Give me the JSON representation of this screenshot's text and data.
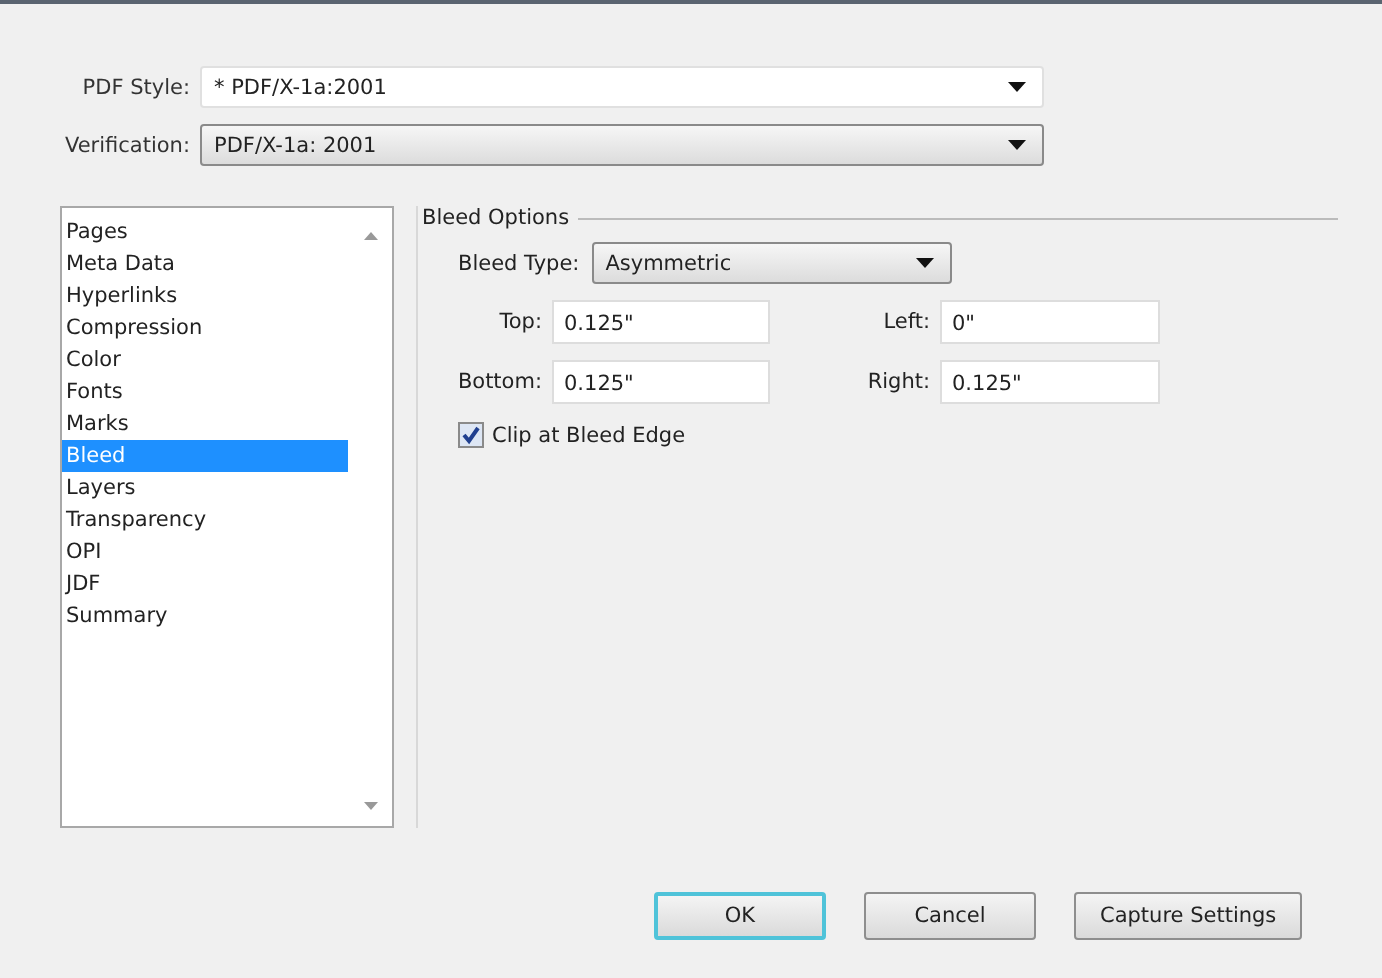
{
  "header_fields": [
    {
      "label": "PDF Style:",
      "value": "* PDF/X-1a:2001",
      "kind": "editable"
    },
    {
      "label": "Verification:",
      "value": "PDF/X-1a: 2001",
      "kind": "dropdown"
    }
  ],
  "sidebar": {
    "items": [
      {
        "label": "Pages",
        "selected": false
      },
      {
        "label": "Meta Data",
        "selected": false
      },
      {
        "label": "Hyperlinks",
        "selected": false
      },
      {
        "label": "Compression",
        "selected": false
      },
      {
        "label": "Color",
        "selected": false
      },
      {
        "label": "Fonts",
        "selected": false
      },
      {
        "label": "Marks",
        "selected": false
      },
      {
        "label": "Bleed",
        "selected": true
      },
      {
        "label": "Layers",
        "selected": false
      },
      {
        "label": "Transparency",
        "selected": false
      },
      {
        "label": "OPI",
        "selected": false
      },
      {
        "label": "JDF",
        "selected": false
      },
      {
        "label": "Summary",
        "selected": false
      }
    ]
  },
  "bleed_options": {
    "title": "Bleed Options",
    "bleed_type": {
      "label": "Bleed Type:",
      "value": "Asymmetric"
    },
    "fields": [
      {
        "label": "Top:",
        "value": "0.125\""
      },
      {
        "label": "Left:",
        "value": "0\""
      },
      {
        "label": "Bottom:",
        "value": "0.125\""
      },
      {
        "label": "Right:",
        "value": "0.125\""
      }
    ],
    "clip": {
      "label": "Clip at Bleed Edge",
      "checked": true
    }
  },
  "buttons": [
    {
      "label": "OK",
      "kind": "default"
    },
    {
      "label": "Cancel",
      "kind": "normal"
    },
    {
      "label": "Capture Settings",
      "kind": "normal"
    }
  ]
}
